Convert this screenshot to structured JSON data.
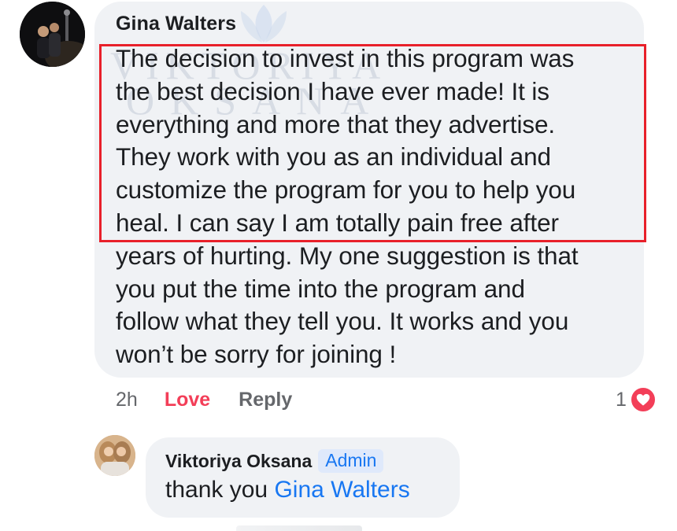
{
  "comment": {
    "author": "Gina Walters",
    "lines": [
      "The decision to invest in this program was",
      "the best decision I have ever made! It is",
      "everything and more that they advertise.",
      "They work with you as an individual and",
      "customize the program for you to help you",
      "heal. I can say I am totally pain free after",
      "years of hurting. My one suggestion is that",
      "you put the time into the program and",
      "follow what they tell you. It works and you",
      "won’t be sorry for joining !"
    ],
    "time": "2h",
    "love_label": "Love",
    "reply_label": "Reply",
    "reaction_count": "1",
    "reaction_icon": "heart-icon",
    "love_color": "#f33e58"
  },
  "watermark": {
    "line1": "VIKTORIYA",
    "line2": "OKSANA"
  },
  "reply": {
    "author": "Viktoriya Oksana",
    "badge": "Admin",
    "text": "thank you ",
    "mention": "Gina Walters",
    "mention_color": "#1877f2"
  },
  "highlight_color": "#e8202a"
}
